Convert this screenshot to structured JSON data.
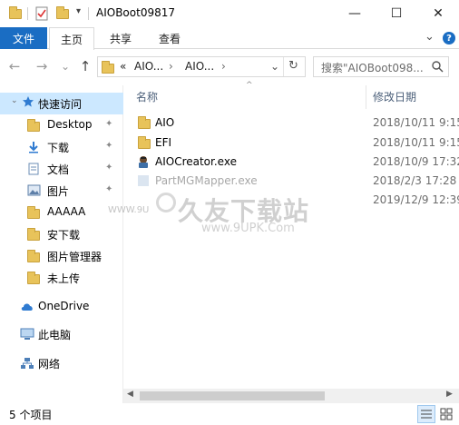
{
  "window": {
    "title": "AIOBoot09817",
    "minimize_glyph": "—",
    "maximize_glyph": "☐",
    "close_glyph": "✕"
  },
  "ribbon": {
    "file_tab": "文件",
    "tabs": [
      "主页",
      "共享",
      "查看"
    ],
    "active_tab_index": 0,
    "expand_glyph": "⌄",
    "help_glyph": "?"
  },
  "nav": {
    "back_glyph": "←",
    "forward_glyph": "→",
    "recent_glyph": "⌄",
    "up_glyph": "↑"
  },
  "address": {
    "overflow": "«",
    "segments": [
      "AIO...",
      "AIO..."
    ],
    "separator": "›",
    "dropdown_glyph": "⌄",
    "refresh_glyph": "↻"
  },
  "search": {
    "placeholder": "搜索\"AIOBoot098...",
    "icon": "search-icon"
  },
  "sidebar": {
    "quick_access": "快速访问",
    "items": [
      {
        "label": "Desktop",
        "icon": "folder-icon",
        "pinned": true
      },
      {
        "label": "下载",
        "icon": "download-icon",
        "pinned": true
      },
      {
        "label": "文档",
        "icon": "document-icon",
        "pinned": true
      },
      {
        "label": "图片",
        "icon": "picture-icon",
        "pinned": true
      },
      {
        "label": "AAAAA",
        "icon": "folder-icon",
        "pinned": false
      },
      {
        "label": "安下载",
        "icon": "folder-icon",
        "pinned": false
      },
      {
        "label": "图片管理器",
        "icon": "folder-icon",
        "pinned": false
      },
      {
        "label": "未上传",
        "icon": "folder-icon",
        "pinned": false
      }
    ],
    "onedrive": "OneDrive",
    "this_pc": "此电脑",
    "network": "网络",
    "pin_glyph": "📌"
  },
  "columns": {
    "name": "名称",
    "modified": "修改日期",
    "sort_glyph": "^"
  },
  "files": [
    {
      "name": "AIO",
      "date": "2018/10/11 9:15",
      "icon": "folder-icon",
      "faded": false
    },
    {
      "name": "EFI",
      "date": "2018/10/11 9:15",
      "icon": "folder-icon",
      "faded": false
    },
    {
      "name": "AIOCreator.exe",
      "date": "2018/10/9 17:32",
      "icon": "exe-icon",
      "faded": false
    },
    {
      "name": "PartMGMapper.exe",
      "date": "2018/2/3 17:28",
      "icon": "exe-icon",
      "faded": true
    },
    {
      "name": "",
      "date": "2019/12/9 12:39",
      "icon": "file-icon",
      "faded": false
    }
  ],
  "watermark": {
    "logo": "久友下载站",
    "url": "www.9UPK.Com",
    "side": "WWW.9U"
  },
  "status": {
    "count": "5 个项目"
  },
  "colors": {
    "accent": "#1a6dc3",
    "selected": "#cce8ff",
    "folder": "#e8c35a"
  }
}
